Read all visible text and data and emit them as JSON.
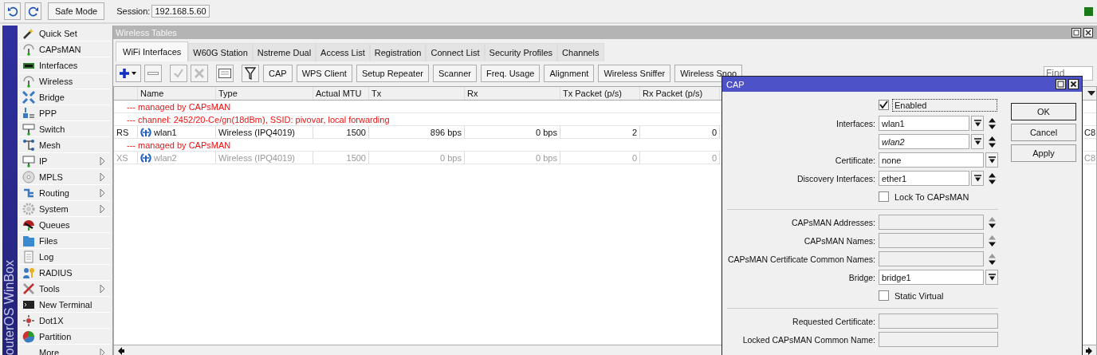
{
  "toolbar": {
    "safe_mode": "Safe Mode",
    "session_label": "Session:",
    "session": "192.168.5.60"
  },
  "sidebar": {
    "brand": "outerOS WinBox",
    "items": [
      {
        "label": "Quick Set",
        "submenu": false
      },
      {
        "label": "CAPsMAN",
        "submenu": false
      },
      {
        "label": "Interfaces",
        "submenu": false
      },
      {
        "label": "Wireless",
        "submenu": false
      },
      {
        "label": "Bridge",
        "submenu": false
      },
      {
        "label": "PPP",
        "submenu": false
      },
      {
        "label": "Switch",
        "submenu": false
      },
      {
        "label": "Mesh",
        "submenu": false
      },
      {
        "label": "IP",
        "submenu": true
      },
      {
        "label": "MPLS",
        "submenu": true
      },
      {
        "label": "Routing",
        "submenu": true
      },
      {
        "label": "System",
        "submenu": true
      },
      {
        "label": "Queues",
        "submenu": false
      },
      {
        "label": "Files",
        "submenu": false
      },
      {
        "label": "Log",
        "submenu": false
      },
      {
        "label": "RADIUS",
        "submenu": false
      },
      {
        "label": "Tools",
        "submenu": true
      },
      {
        "label": "New Terminal",
        "submenu": false
      },
      {
        "label": "Dot1X",
        "submenu": false
      },
      {
        "label": "Partition",
        "submenu": false
      },
      {
        "label": "More",
        "submenu": true
      }
    ]
  },
  "window": {
    "title": "Wireless Tables",
    "tabs": [
      {
        "label": "WiFi Interfaces",
        "selected": true
      },
      {
        "label": "W60G Station",
        "selected": false
      },
      {
        "label": "Nstreme Dual",
        "selected": false
      },
      {
        "label": "Access List",
        "selected": false
      },
      {
        "label": "Registration",
        "selected": false
      },
      {
        "label": "Connect List",
        "selected": false
      },
      {
        "label": "Security Profiles",
        "selected": false
      },
      {
        "label": "Channels",
        "selected": false
      }
    ],
    "buttons": [
      "CAP",
      "WPS Client",
      "Setup Repeater",
      "Scanner",
      "Freq. Usage",
      "Alignment",
      "Wireless Sniffer",
      "Wireless Snoo"
    ],
    "find": {
      "placeholder": "Find"
    },
    "table": {
      "columns": [
        "Name",
        "Type",
        "Actual MTU",
        "Tx",
        "Rx",
        "Tx Packet (p/s)",
        "Rx Packet (p/s)"
      ],
      "rows": [
        {
          "kind": "comment",
          "text": "--- managed by CAPsMAN"
        },
        {
          "kind": "comment",
          "text": "--- channel: 2452/20-Ce/gn(18dBm), SSID: pivovar, local forwarding"
        },
        {
          "kind": "interface",
          "flags": "RS",
          "name": "wlan1",
          "type": "Wireless (IPQ4019)",
          "mtu": "1500",
          "tx": "896 bps",
          "rx": "0 bps",
          "tx_packet": "2",
          "rx_packet": "0",
          "column_9": "C8",
          "disabled": false
        },
        {
          "kind": "comment",
          "text": "--- managed by CAPsMAN"
        },
        {
          "kind": "interface",
          "flags": "XS",
          "name": "wlan2",
          "type": "Wireless (IPQ4019)",
          "mtu": "1500",
          "tx": "0 bps",
          "rx": "0 bps",
          "tx_packet": "0",
          "rx_packet": "0",
          "column_9": "C8",
          "disabled": true
        }
      ]
    }
  },
  "dialog": {
    "title": "CAP",
    "fields": [
      {
        "kind": "checkbox",
        "label": "Enabled",
        "checked": true
      },
      {
        "kind": "select",
        "label": "Interfaces:",
        "value": "wlan1",
        "spinner": true,
        "inactive": false
      },
      {
        "kind": "select",
        "value": "wlan2",
        "spinner": true,
        "inactive": true
      },
      {
        "kind": "select",
        "label": "Certificate:",
        "value": "none",
        "spinner": false,
        "inactive": false
      },
      {
        "kind": "select",
        "label": "Discovery Interfaces:",
        "value": "ether1",
        "spinner": true,
        "inactive": false
      },
      {
        "kind": "checkbox",
        "label": "Lock To CAPsMAN",
        "checked": false
      },
      {
        "kind": "separator"
      },
      {
        "kind": "list",
        "label": "CAPsMAN Addresses:"
      },
      {
        "kind": "list",
        "label": "CAPsMAN Names:"
      },
      {
        "kind": "list",
        "label": "CAPsMAN Certificate Common Names:"
      },
      {
        "kind": "select",
        "label": "Bridge:",
        "value": "bridge1",
        "spinner": false,
        "inactive": false
      },
      {
        "kind": "checkbox",
        "label": "Static Virtual",
        "checked": false
      },
      {
        "kind": "separator"
      },
      {
        "kind": "readonly",
        "label": "Requested Certificate:"
      },
      {
        "kind": "readonly",
        "label": "Locked CAPsMAN Common Name:"
      }
    ],
    "buttons": [
      "OK",
      "Cancel",
      "Apply"
    ]
  }
}
